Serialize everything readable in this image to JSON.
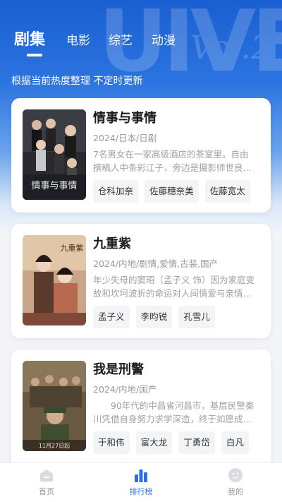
{
  "header": {
    "tabs": [
      {
        "label": "剧集",
        "active": true
      },
      {
        "label": "电影",
        "active": false
      },
      {
        "label": "综艺",
        "active": false
      },
      {
        "label": "动漫",
        "active": false
      }
    ],
    "subtitle": "根据当前热度整理 不定时更新"
  },
  "shows": [
    {
      "title": "情事与事情",
      "meta": "2024/日本/日剧",
      "desc_line1": "7名男女在一家高级酒店的茶室里。自由",
      "desc_line2": "撰稿人中条彩江子，旁边是摄影师世良...",
      "cast": [
        "仓科加奈",
        "佐藤穗奈美",
        "佐藤宽太"
      ],
      "poster_text": "情事与事情"
    },
    {
      "title": "九重紫",
      "meta": "2024/内地/剧情,爱情,古装,国产",
      "desc_line1": "年少失母的窦昭（孟子义 饰）因为家庭变",
      "desc_line2": "故和坎坷波折的命运对人间情爱与亲情...",
      "cast": [
        "孟子义",
        "李昀锐",
        "孔雪儿"
      ],
      "poster_text": "九重紫"
    },
    {
      "title": "我是刑警",
      "meta": "2024/内地/国产",
      "desc_line1": "　　90年代的中昌省河昌市，基层民警秦",
      "desc_line2": "川凭借自身努力求学深造，终于如愿成...",
      "cast": [
        "于和伟",
        "富大龙",
        "丁勇岱",
        "白凡"
      ],
      "poster_text": "11月27日起"
    }
  ],
  "bottom_nav": [
    {
      "label": "首页",
      "icon": "home-icon",
      "active": false
    },
    {
      "label": "排行榜",
      "icon": "ranking-icon",
      "active": true
    },
    {
      "label": "我的",
      "icon": "profile-icon",
      "active": false
    }
  ],
  "colors": {
    "accent": "#2b6fe0",
    "hero_top": "#1a5fd1",
    "page_bg": "#f2f4f8"
  }
}
